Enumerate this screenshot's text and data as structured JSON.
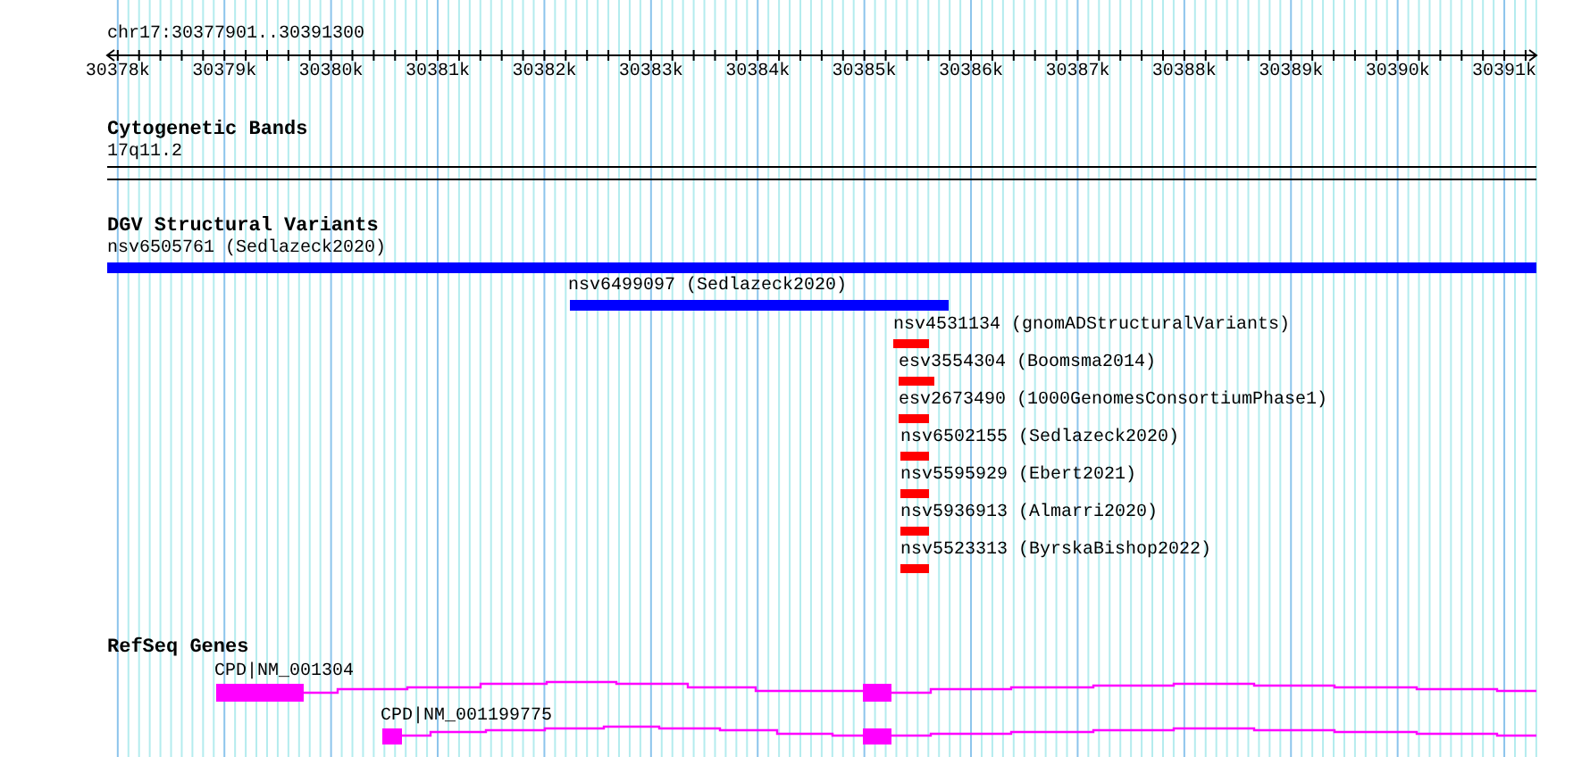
{
  "location": "chr17:30377901..30391300",
  "ruler": {
    "ticks": [
      "30378k",
      "30379k",
      "30380k",
      "30381k",
      "30382k",
      "30383k",
      "30384k",
      "30385k",
      "30386k",
      "30387k",
      "30388k",
      "30389k",
      "30390k",
      "30391k"
    ]
  },
  "tracks": [
    {
      "title": "Cytogenetic Bands",
      "kind": "bands",
      "features": [
        {
          "label": "17q11.2"
        }
      ]
    },
    {
      "title": "DGV Structural Variants",
      "kind": "variants",
      "features": [
        {
          "label": "nsv6505761 (Sedlazeck2020)",
          "color": "#0000ff"
        },
        {
          "label": "nsv6499097 (Sedlazeck2020)",
          "color": "#0000ff"
        },
        {
          "label": "nsv4531134 (gnomADStructuralVariants)",
          "color": "#ff0000"
        },
        {
          "label": "esv3554304 (Boomsma2014)",
          "color": "#ff0000"
        },
        {
          "label": "esv2673490 (1000GenomesConsortiumPhase1)",
          "color": "#ff0000"
        },
        {
          "label": "nsv6502155 (Sedlazeck2020)",
          "color": "#ff0000"
        },
        {
          "label": "nsv5595929 (Ebert2021)",
          "color": "#ff0000"
        },
        {
          "label": "nsv5936913 (Almarri2020)",
          "color": "#ff0000"
        },
        {
          "label": "nsv5523313 (ByrskaBishop2022)",
          "color": "#ff0000"
        }
      ]
    },
    {
      "title": "RefSeq Genes",
      "kind": "genes",
      "features": [
        {
          "label": "CPD|NM_001304"
        },
        {
          "label": "CPD|NM_001199775"
        }
      ]
    }
  ]
}
